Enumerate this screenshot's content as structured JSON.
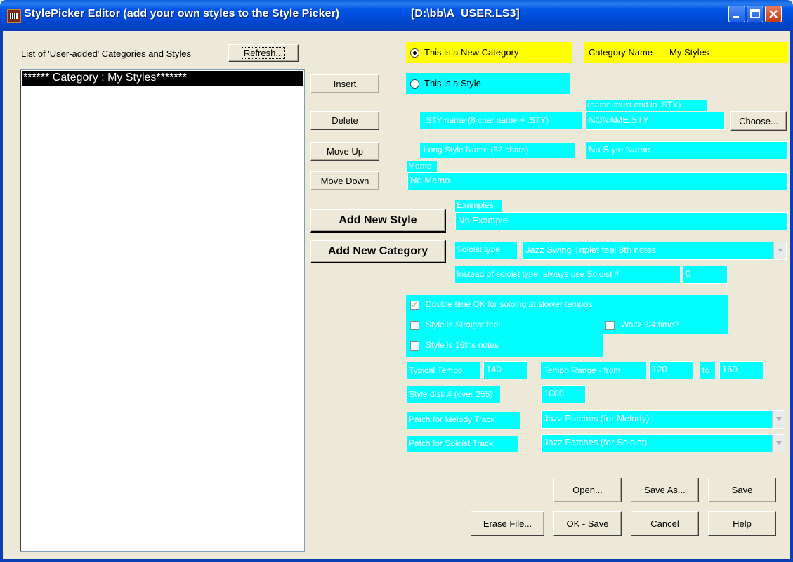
{
  "window": {
    "title": "StylePicker Editor (add your own styles to the Style Picker)",
    "file_path": "[D:\\bb\\A_USER.LS3]"
  },
  "list": {
    "label": "List of 'User-added' Categories and Styles",
    "refresh_label": "Refresh...",
    "items": [
      "****** Category : My Styles*******"
    ]
  },
  "buttons": {
    "insert": "Insert",
    "delete": "Delete",
    "move_up": "Move Up",
    "move_down": "Move Down",
    "add_style": "Add New Style",
    "add_category": "Add New Category",
    "choose": "Choose...",
    "open": "Open...",
    "save_as": "Save As...",
    "save": "Save",
    "erase_file": "Erase File...",
    "ok_save": "OK - Save",
    "cancel": "Cancel",
    "help": "Help"
  },
  "form": {
    "new_category_label": "This is a New Category",
    "new_category_selected": true,
    "style_label": "This is a Style",
    "category_name_label": "Category Name",
    "category_name_value": "My Styles",
    "sty_name_label": ".STY name (8 char name + .STY)",
    "sty_name_hint": "(name must end in .STY)",
    "sty_name_value": "NONAME.STY",
    "long_name_label": "Long Style Name (32 chars)",
    "long_name_value": "No Style Name",
    "memo_label": "Memo",
    "memo_value": "No Memo",
    "examples_label": "Examples",
    "examples_value": "No Example",
    "soloist_type_label": "Soloist type",
    "soloist_type_value": "Jazz Swing Triplet feel 8th notes",
    "soloist_override_label": "Instead of soloist type, always  use Soloist #",
    "soloist_override_value": "0",
    "double_time_label": "Double time OK for soloing at slower tempos",
    "double_time_checked": true,
    "straight_feel_label": "Style is Straight feel",
    "waltz_label": "Waltz 3/4 time?",
    "sixteenths_label": "Style is 16ths notes",
    "typical_tempo_label": "Typical Tempo",
    "typical_tempo_value": "140",
    "tempo_range_label": "Tempo Range - from",
    "tempo_from_value": "120",
    "tempo_to_label": "to",
    "tempo_to_value": "160",
    "style_disk_label": "Style disk #  (over 255)",
    "style_disk_value": "1000",
    "melody_patch_label": "Patch for Melody Track",
    "melody_patch_value": "Jazz Patches (for Melody)",
    "soloist_patch_label": "Patch for Soloist Track",
    "soloist_patch_value": "Jazz Patches (for Soloist)"
  },
  "colors": {
    "accent": "#00ffff",
    "highlight": "#ffff00",
    "titlebar": "#0055e5"
  }
}
